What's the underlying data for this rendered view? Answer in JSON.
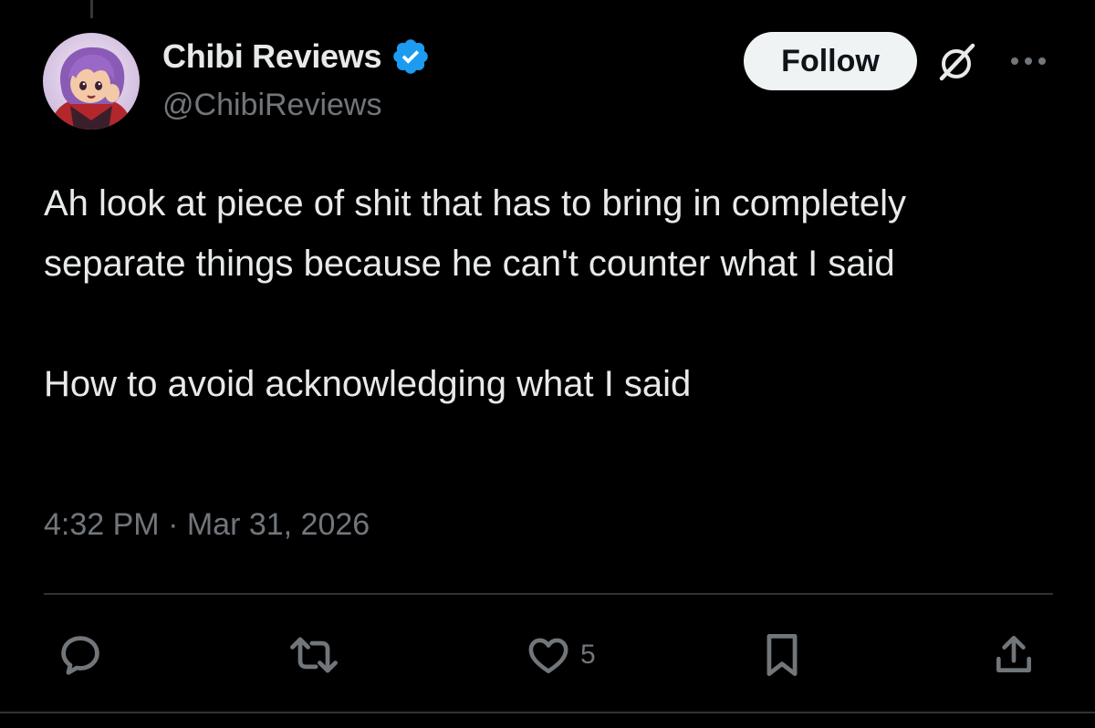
{
  "author": {
    "display_name": "Chibi Reviews",
    "handle": "@ChibiReviews",
    "verified_color": "#1d9bf0",
    "avatar_icon": "anime-character-avatar"
  },
  "header": {
    "follow_label": "Follow",
    "grok_icon": "grok-slash-icon",
    "more_icon": "more-horizontal-icon"
  },
  "tweet": {
    "text": "Ah look at piece of shit that has to bring in completely separate things because he can't counter what I said\n\nHow to avoid acknowledging what I said",
    "timestamp": "4:32 PM · Mar 31, 2026"
  },
  "actions": {
    "reply_icon": "reply-icon",
    "retweet_icon": "retweet-icon",
    "like_icon": "heart-icon",
    "like_count": "5",
    "bookmark_icon": "bookmark-icon",
    "share_icon": "share-icon"
  },
  "colors": {
    "background": "#000000",
    "text_primary": "#e7e9ea",
    "text_secondary": "#71767b",
    "follow_bg": "#eff3f4",
    "follow_text": "#0f1419",
    "divider": "#2f3336"
  }
}
